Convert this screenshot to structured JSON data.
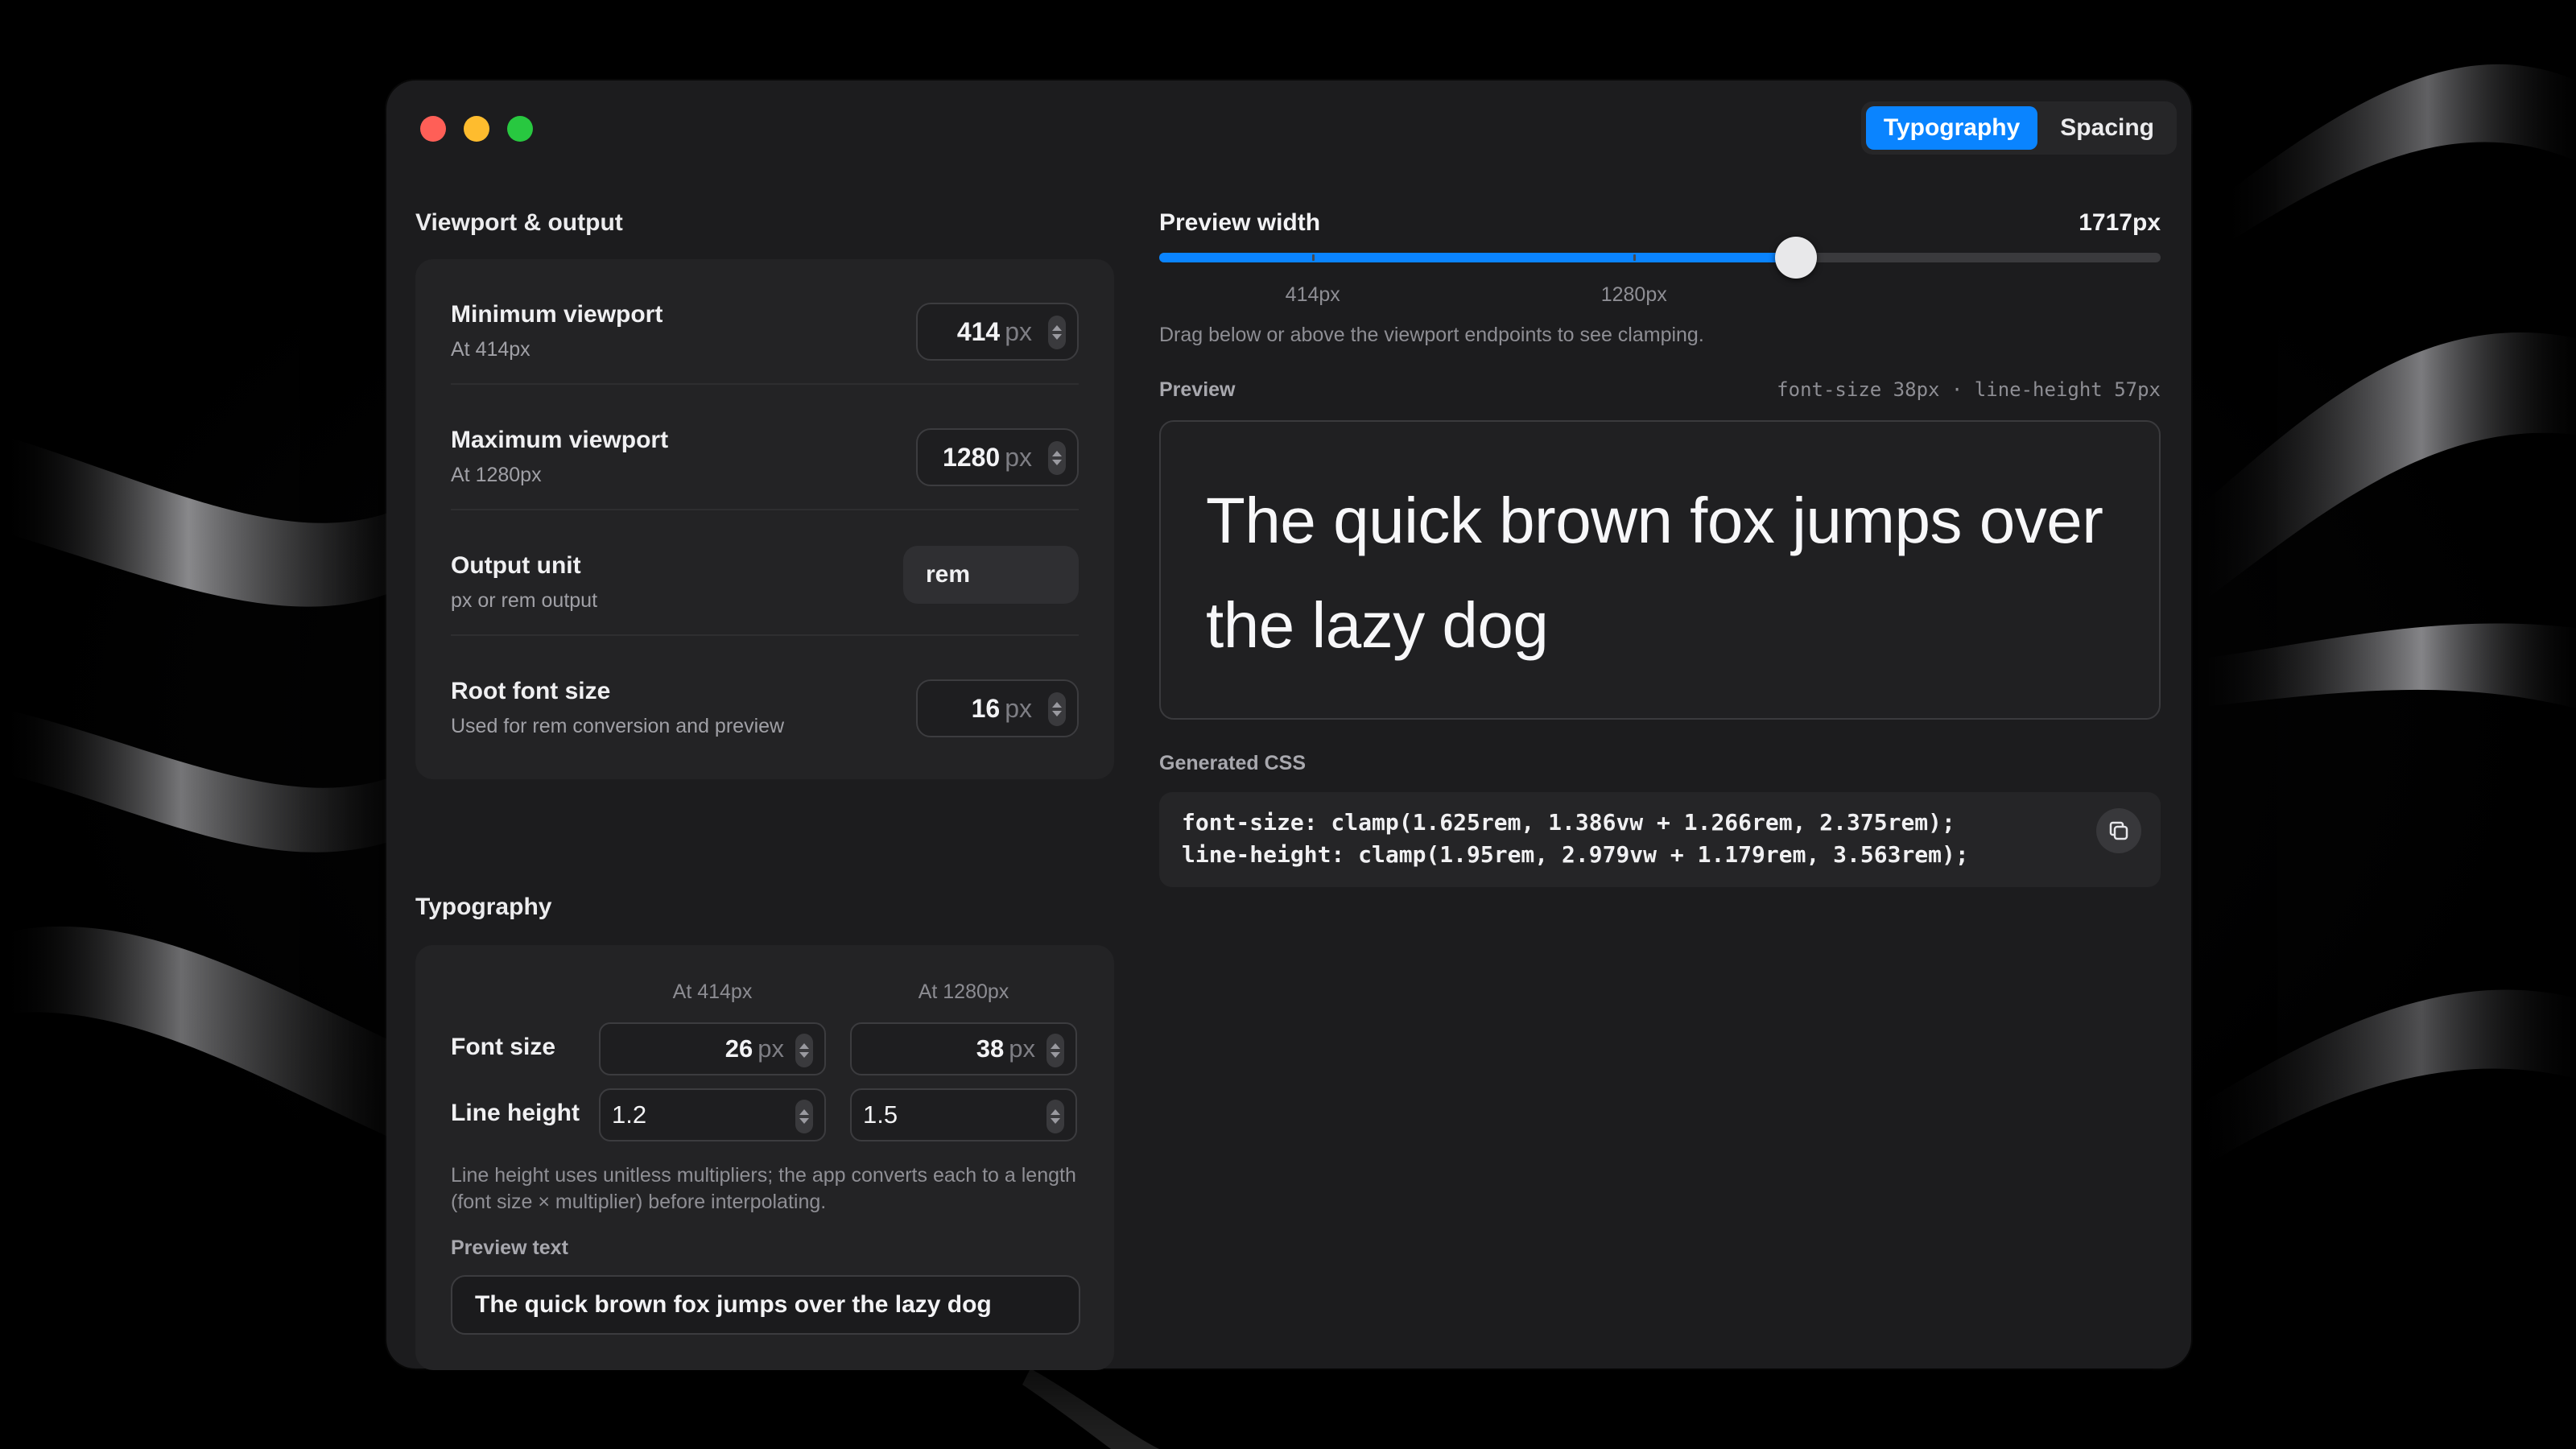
{
  "tabs": [
    {
      "label": "Typography",
      "active": true
    },
    {
      "label": "Spacing",
      "active": false
    }
  ],
  "left": {
    "viewport_title": "Viewport & output",
    "rows": [
      {
        "label": "Minimum viewport",
        "sub": "At 414px",
        "value": "414",
        "unit": "px"
      },
      {
        "label": "Maximum viewport",
        "sub": "At 1280px",
        "value": "1280",
        "unit": "px"
      },
      {
        "label": "Output unit",
        "sub": "px or rem output",
        "value": "rem"
      },
      {
        "label": "Root font size",
        "sub": "Used for rem conversion and preview",
        "value": "16",
        "unit": "px"
      }
    ],
    "typography_title": "Typography",
    "typography": {
      "col_min": "At 414px",
      "col_max": "At 1280px",
      "font_size_label": "Font size",
      "font_size_min": "26",
      "font_size_max": "38",
      "font_size_unit": "px",
      "line_height_label": "Line height",
      "line_height_min": "1.2",
      "line_height_max": "1.5",
      "note": "Line height uses unitless multipliers; the app converts each to a length (font size × multiplier) before interpolating.",
      "preview_text_label": "Preview text",
      "preview_text_value": "The quick brown fox jumps over the lazy dog"
    }
  },
  "right": {
    "preview_width_label": "Preview width",
    "preview_width_value": "1717px",
    "slider": {
      "min": 0,
      "max": 2700,
      "value": 1717,
      "marks": [
        {
          "label": "414px",
          "value": 414
        },
        {
          "label": "1280px",
          "value": 1280
        }
      ]
    },
    "hint": "Drag below or above the viewport endpoints to see clamping.",
    "preview_label": "Preview",
    "preview_meta": "font-size 38px · line-height 57px",
    "preview_text": "The quick brown fox jumps over the lazy dog",
    "generated_label": "Generated CSS",
    "css_line1": "font-size: clamp(1.625rem, 1.386vw + 1.266rem, 2.375rem);",
    "css_line2": "line-height: clamp(1.95rem, 2.979vw + 1.179rem, 3.563rem);"
  },
  "colors": {
    "accent": "#0a84ff",
    "window_bg": "#1c1c1e",
    "card_bg": "#232325"
  }
}
